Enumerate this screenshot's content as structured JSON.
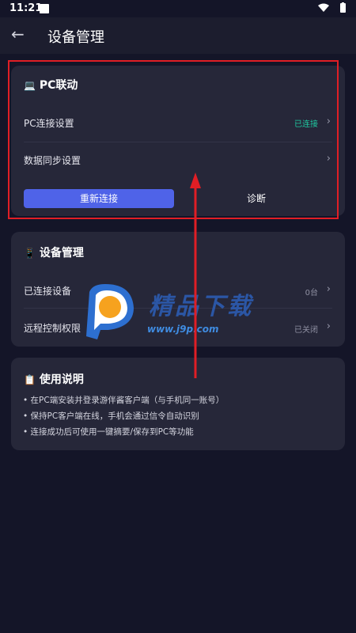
{
  "status_bar": {
    "time": "11:21"
  },
  "header": {
    "title": "设备管理"
  },
  "pc_section": {
    "title": "PC联动",
    "icon": "laptop-icon",
    "rows": [
      {
        "label": "PC连接设置",
        "value": "已连接"
      },
      {
        "label": "数据同步设置",
        "value": ""
      }
    ],
    "reconnect_label": "重新连接",
    "diagnose_label": "诊断"
  },
  "device_section": {
    "title": "设备管理",
    "icon": "phone-icon",
    "rows": [
      {
        "label": "已连接设备",
        "value": "0台"
      },
      {
        "label": "远程控制权限",
        "value": "已关闭"
      }
    ]
  },
  "guide_section": {
    "title": "使用说明",
    "icon": "clipboard-icon",
    "lines": [
      "• 在PC端安装并登录游伴酱客户端（与手机同一账号）",
      "• 保持PC客户端在线，手机会通过信令自动识别",
      "• 连接成功后可使用一键摘要/保存到PC等功能"
    ]
  },
  "watermark": {
    "brand": "精品下载",
    "url": "www.j9p.com"
  },
  "colors": {
    "accent": "#4f63e8",
    "connected": "#1fc8a0",
    "highlight": "#e01e25"
  }
}
